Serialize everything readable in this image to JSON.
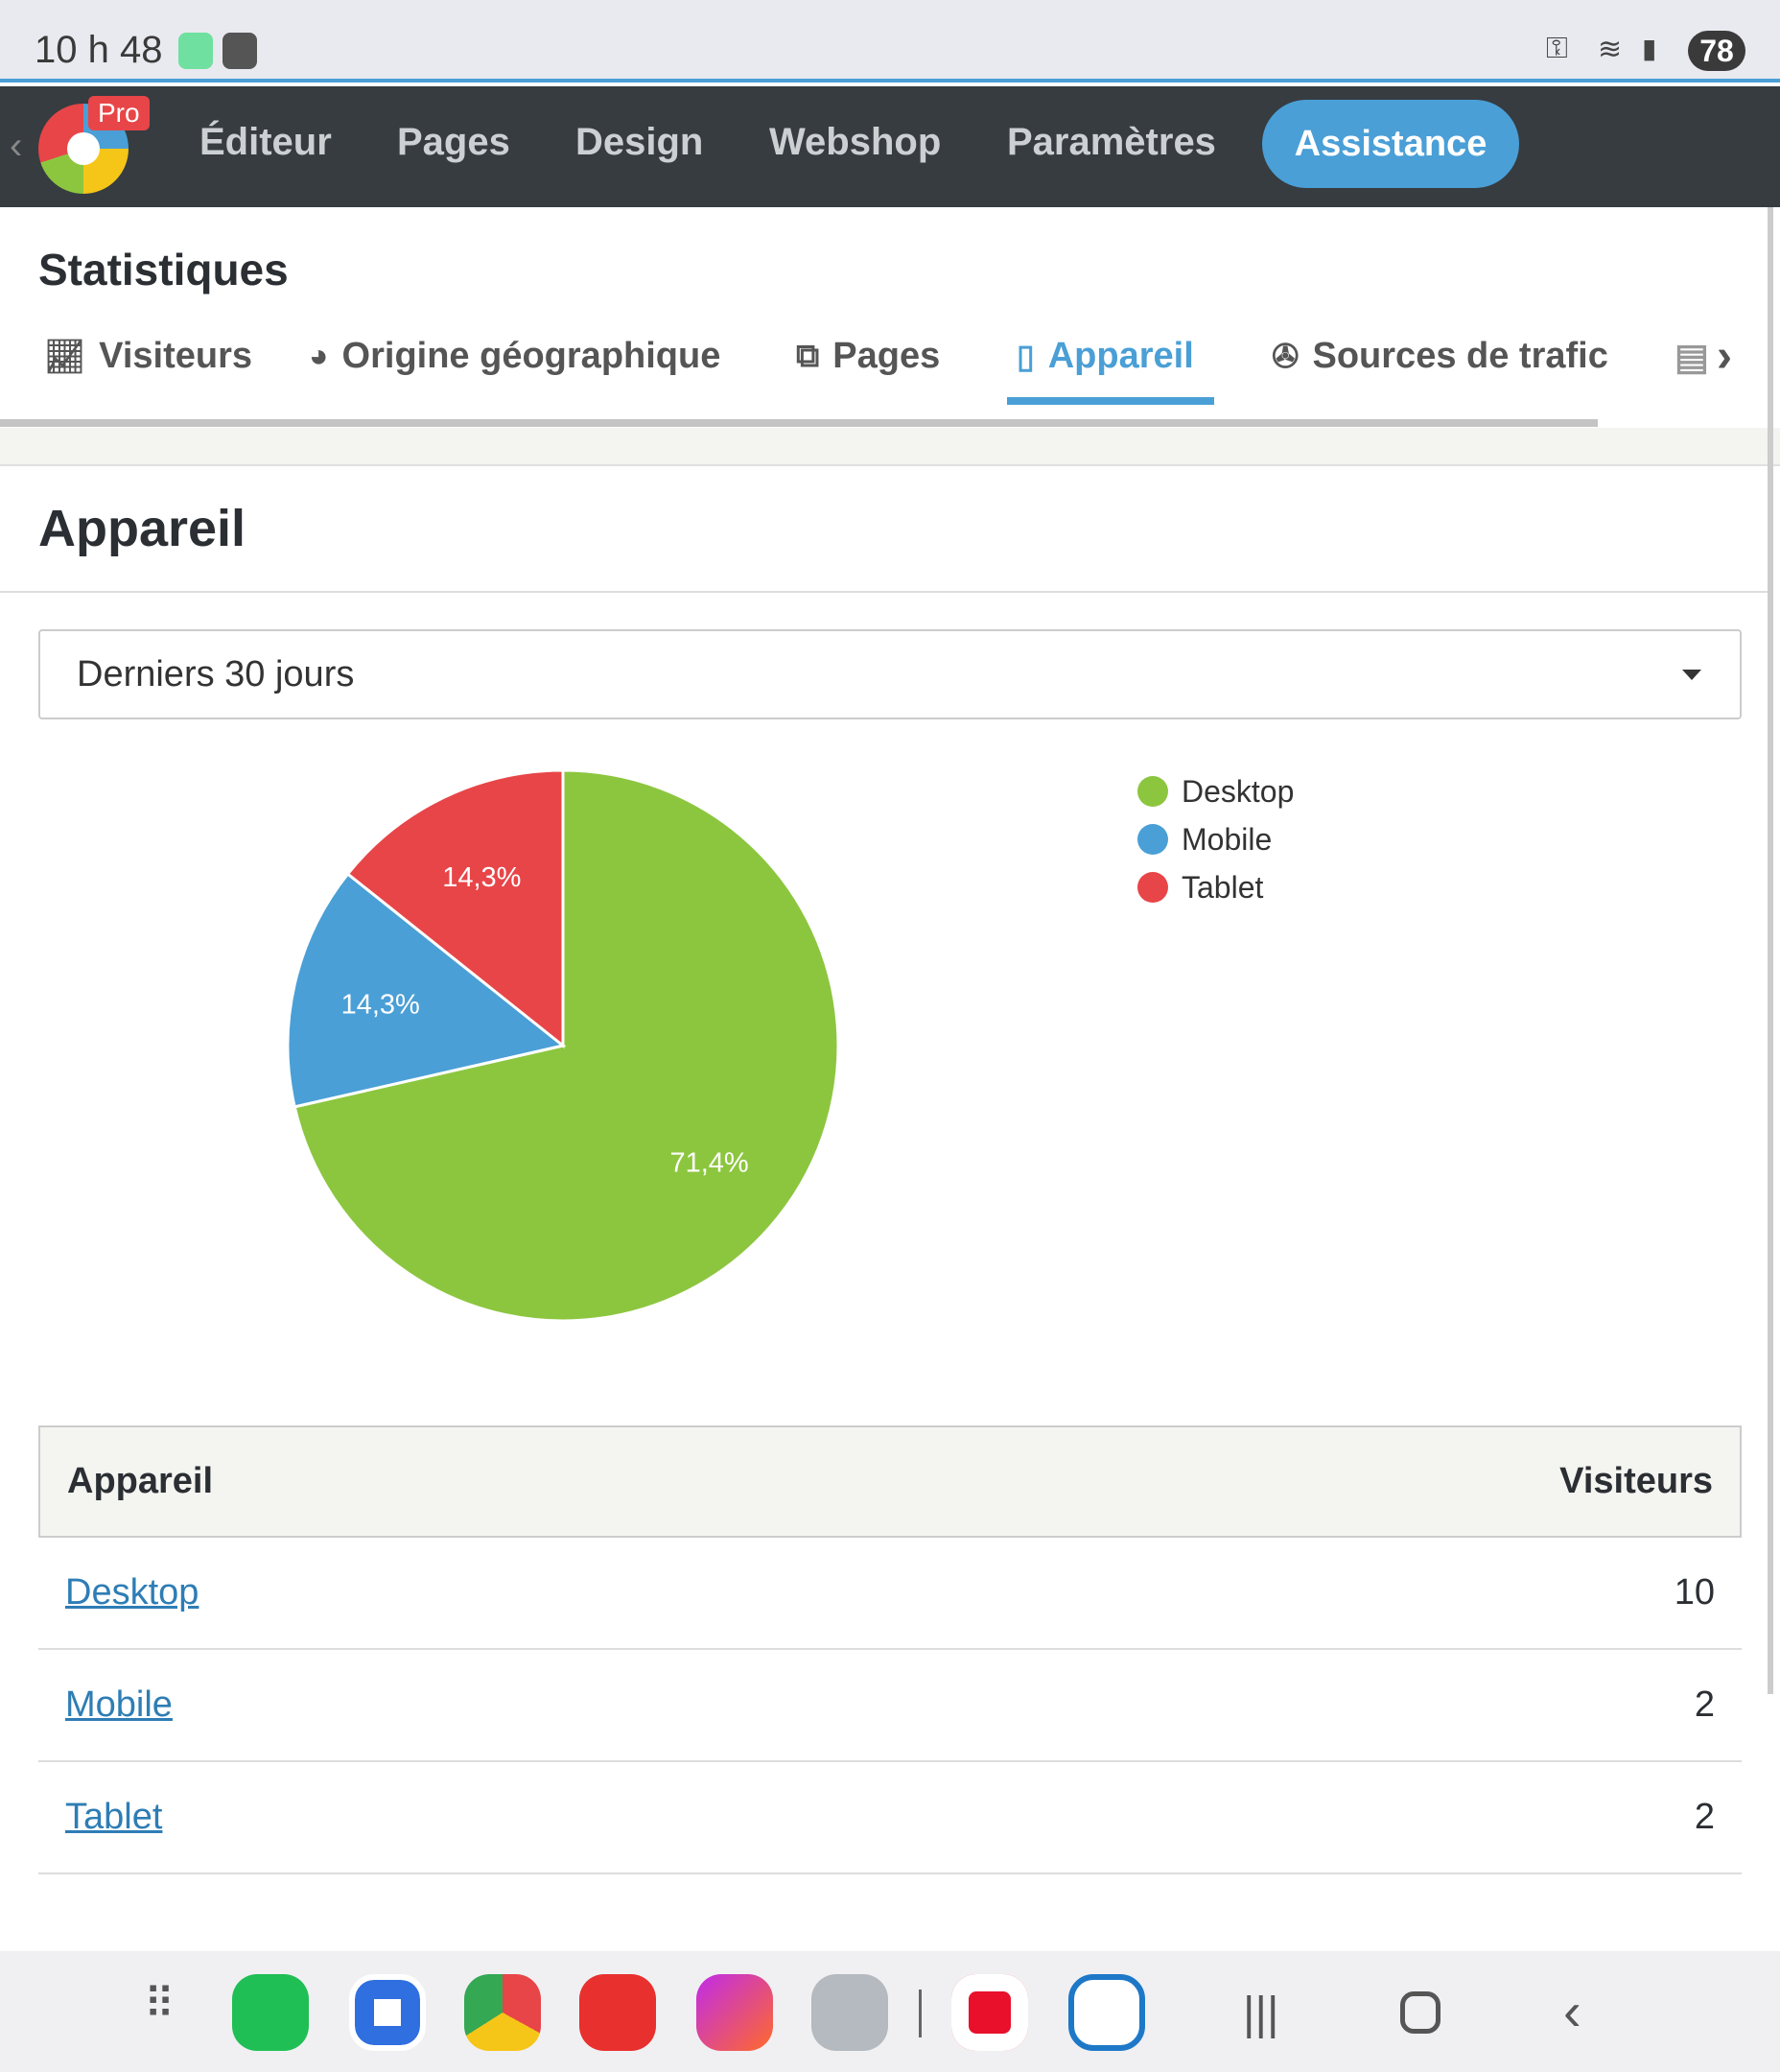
{
  "status_bar": {
    "time": "10 h 48",
    "battery": "78"
  },
  "nav": {
    "badge": "Pro",
    "items": [
      "Éditeur",
      "Pages",
      "Design",
      "Webshop",
      "Paramètres"
    ],
    "assistance": "Assistance"
  },
  "page_title": "Statistiques",
  "tabs": [
    {
      "label": "Visiteurs",
      "icon": "chart-line-icon"
    },
    {
      "label": "Origine géographique",
      "icon": "globe-icon"
    },
    {
      "label": "Pages",
      "icon": "pages-icon"
    },
    {
      "label": "Appareil",
      "icon": "mobile-icon"
    },
    {
      "label": "Sources de trafic",
      "icon": "network-icon"
    }
  ],
  "section_title": "Appareil",
  "period_select": "Derniers 30 jours",
  "chart_data": {
    "type": "pie",
    "categories": [
      "Desktop",
      "Mobile",
      "Tablet"
    ],
    "values": [
      10,
      2,
      2
    ],
    "labels": [
      "71,4%",
      "14,3%",
      "14,3%"
    ],
    "colors": [
      "#8cc63f",
      "#4a9fd6",
      "#e84548"
    ],
    "legend": "top-right"
  },
  "table": {
    "headers": [
      "Appareil",
      "Visiteurs"
    ],
    "rows": [
      {
        "device": "Desktop",
        "visitors": "10"
      },
      {
        "device": "Mobile",
        "visitors": "2"
      },
      {
        "device": "Tablet",
        "visitors": "2"
      }
    ]
  }
}
